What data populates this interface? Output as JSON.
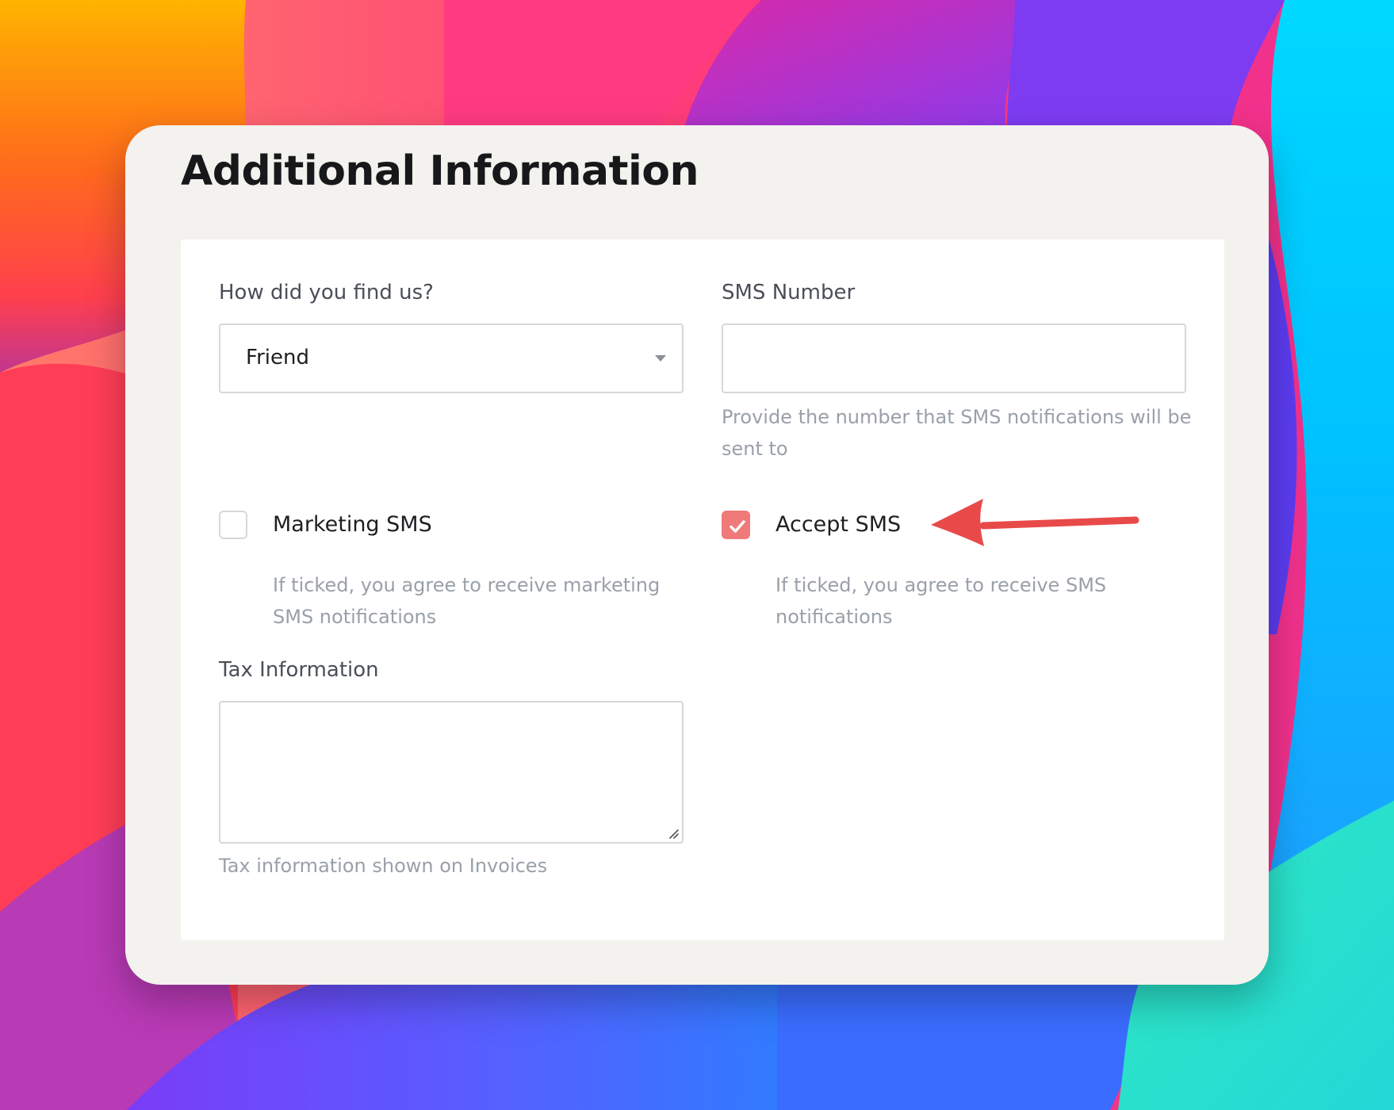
{
  "colors": {
    "checkbox_checked": "#f07a7a",
    "annotation_arrow": "#e84a4a",
    "card_background": "#f3f2ee",
    "panel_background": "#ffffff"
  },
  "title": "Additional Information",
  "form": {
    "find_us": {
      "label": "How did you find us?",
      "value": "Friend",
      "icon": "caret-down-icon"
    },
    "sms_number": {
      "label": "SMS Number",
      "value": "",
      "help": "Provide the number that SMS notifications will be sent to"
    },
    "marketing_sms": {
      "label": "Marketing SMS",
      "checked": false,
      "help": "If ticked, you agree to receive marketing SMS notifications"
    },
    "accept_sms": {
      "label": "Accept SMS",
      "checked": true,
      "help": "If ticked, you agree to receive SMS notifications"
    },
    "tax_information": {
      "label": "Tax Information",
      "value": "",
      "help": "Tax information shown on Invoices"
    }
  },
  "annotation": {
    "icon": "arrow-left-icon"
  }
}
